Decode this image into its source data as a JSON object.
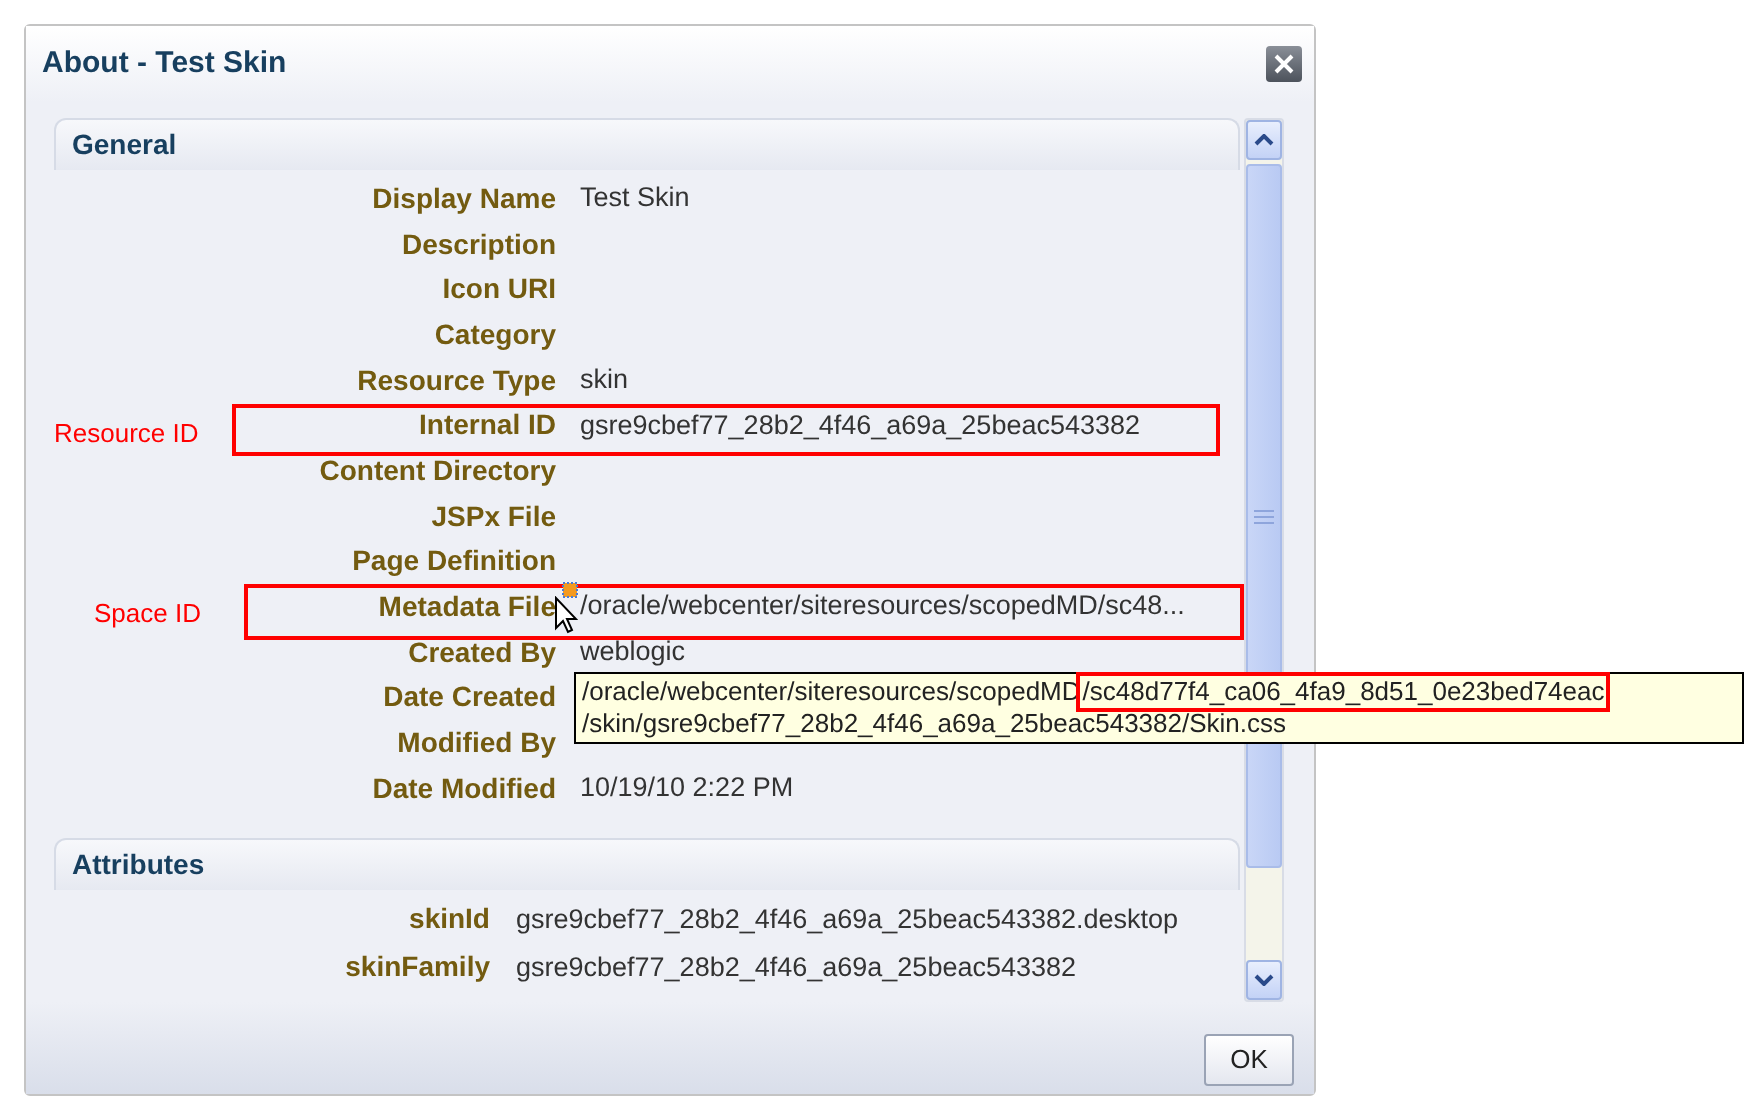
{
  "dialog": {
    "title": "About - Test Skin",
    "ok_button": "OK"
  },
  "sections": [
    {
      "title": "General",
      "rows": [
        {
          "label": "Display Name",
          "value": "Test Skin"
        },
        {
          "label": "Description"
        },
        {
          "label": "Icon URI"
        },
        {
          "label": "Category"
        },
        {
          "label": "Resource Type",
          "value": "skin"
        },
        {
          "label": "Internal ID",
          "value": "gsre9cbef77_28b2_4f46_a69a_25beac543382"
        },
        {
          "label": "Content Directory"
        },
        {
          "label": "JSPx File"
        },
        {
          "label": "Page Definition"
        },
        {
          "label": "Metadata File",
          "value": "/oracle/webcenter/siteresources/scopedMD/sc48..."
        },
        {
          "label": "Created By",
          "value": "weblogic"
        },
        {
          "label": "Date Created"
        },
        {
          "label": "Modified By"
        },
        {
          "label": "Date Modified",
          "value": "10/19/10 2:22 PM"
        }
      ]
    },
    {
      "title": "Attributes",
      "rows": [
        {
          "label": "skinId",
          "value": "gsre9cbef77_28b2_4f46_a69a_25beac543382.desktop"
        },
        {
          "label": "skinFamily",
          "value": "gsre9cbef77_28b2_4f46_a69a_25beac543382"
        }
      ]
    }
  ],
  "annotations": [
    {
      "label": "Resource ID"
    },
    {
      "label": "Space ID"
    }
  ],
  "tooltip": {
    "line_1": "/oracle/webcenter/siteresources/scopedMD",
    "line_1_highlight": "/sc48d77f4_ca06_4fa9_8d51_0e23bed74eac",
    "line_2": "/skin/gsre9cbef77_28b2_4f46_a69a_25beac543382/Skin.css"
  }
}
